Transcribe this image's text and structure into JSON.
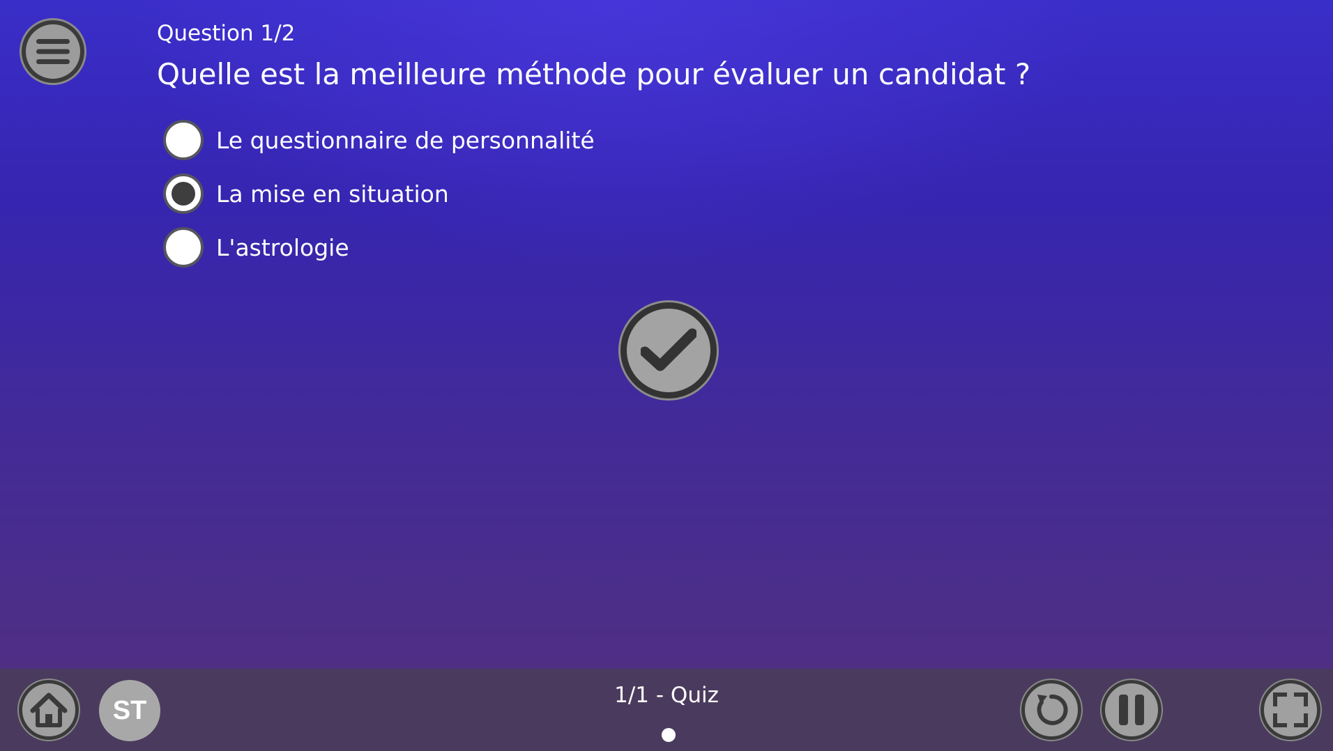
{
  "quiz": {
    "question_number": "Question 1/2",
    "question_text": "Quelle est la meilleure méthode pour évaluer un candidat ?",
    "options": [
      {
        "label": "Le questionnaire de personnalité",
        "selected": false
      },
      {
        "label": "La mise en situation",
        "selected": true
      },
      {
        "label": "L'astrologie",
        "selected": false
      }
    ],
    "submit_icon": "checkmark-icon"
  },
  "toolbar": {
    "menu_icon": "hamburger-menu-icon",
    "home_icon": "home-icon",
    "user_initials": "ST",
    "slide_label": "1/1 - Quiz",
    "replay_icon": "replay-icon",
    "pause_icon": "pause-icon",
    "fullscreen_icon": "fullscreen-icon"
  },
  "colors": {
    "background_top": "#3a2ec9",
    "background_bottom": "#4f2f84",
    "bottom_bar": "#4a3b5e",
    "button_gray": "#a0a0a0",
    "button_dark": "#3a3a3a",
    "text": "#ffffff"
  }
}
